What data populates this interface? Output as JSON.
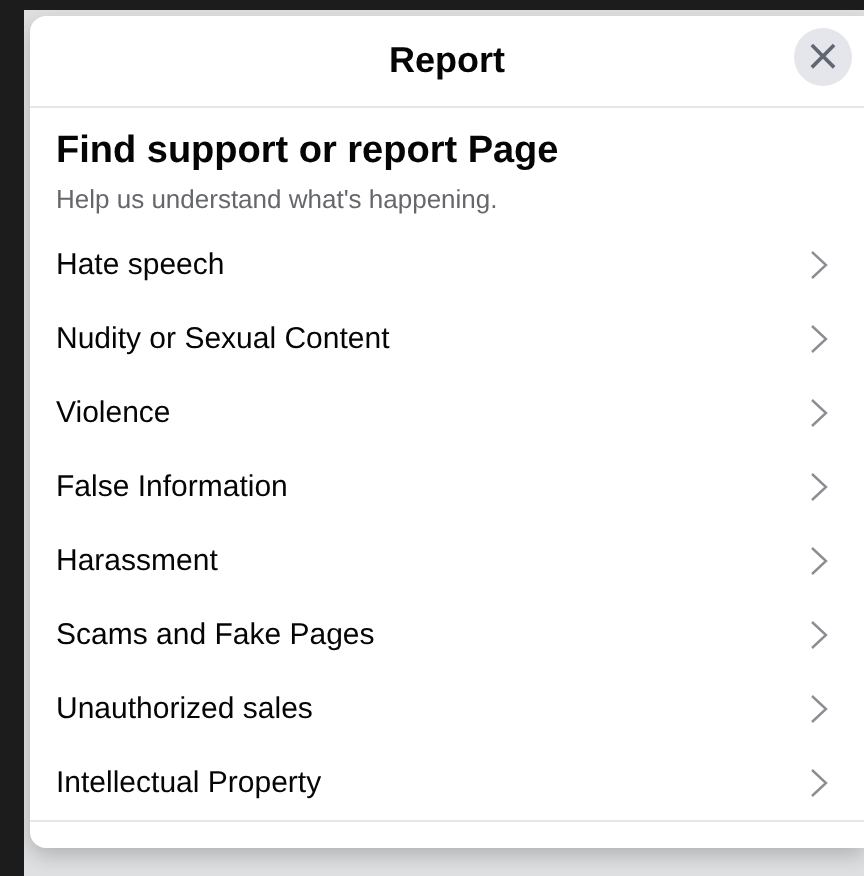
{
  "dialog": {
    "title": "Report",
    "close": "×"
  },
  "heading": "Find support or report Page",
  "subtitle": "Help us understand what's happening.",
  "options": [
    {
      "label": "Hate speech"
    },
    {
      "label": "Nudity or Sexual Content"
    },
    {
      "label": "Violence"
    },
    {
      "label": "False Information"
    },
    {
      "label": "Harassment"
    },
    {
      "label": "Scams and Fake Pages"
    },
    {
      "label": "Unauthorized sales"
    },
    {
      "label": "Intellectual Property"
    }
  ]
}
